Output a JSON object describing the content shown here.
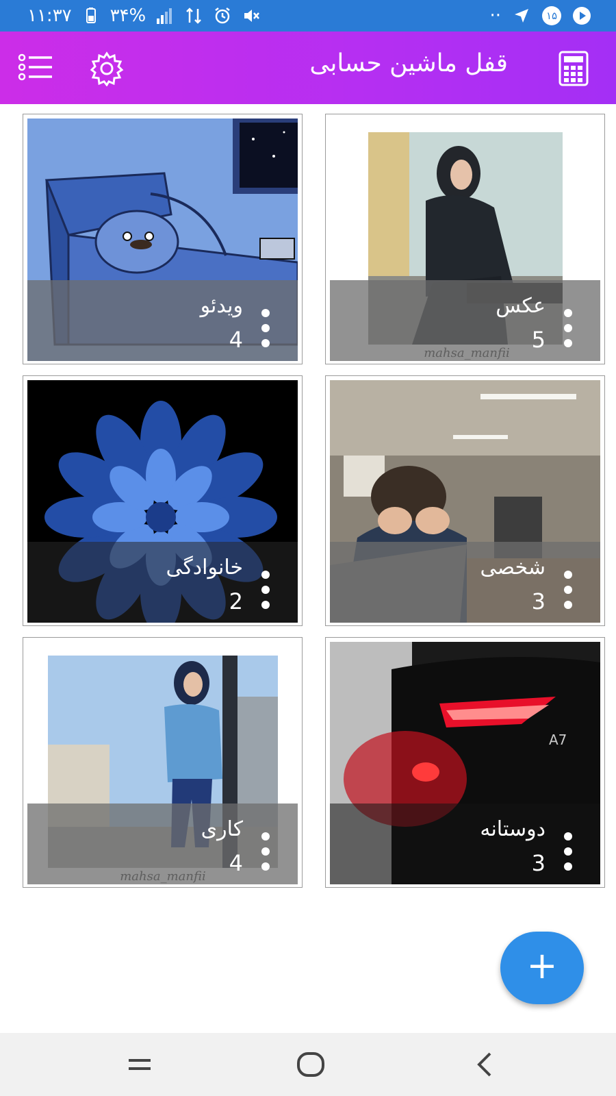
{
  "status_bar": {
    "time": "۱۱:۳۷",
    "battery": "۳۴%",
    "right_text": "··",
    "notification_count": "۱۵"
  },
  "app_bar": {
    "title": "قفل ماشین حسابی",
    "menu_icon": "menu-list-icon",
    "settings_icon": "gear-icon",
    "calculator_icon": "calculator-icon",
    "color_start": "#cc2de8",
    "color_end": "#a42ff5"
  },
  "folders": [
    {
      "name": "عکس",
      "count": "5",
      "thumb": "woman-sitting-photo",
      "caption": "mahsa_manfii"
    },
    {
      "name": "ویدئو",
      "count": "4",
      "thumb": "cartoon-bird-in-bed",
      "caption": ""
    },
    {
      "name": "شخصی",
      "count": "3",
      "thumb": "man-at-laptop-photo",
      "caption": ""
    },
    {
      "name": "خانوادگی",
      "count": "2",
      "thumb": "blue-flower-photo",
      "caption": ""
    },
    {
      "name": "دوستانه",
      "count": "3",
      "thumb": "red-car-taillight-photo",
      "caption": "A7"
    },
    {
      "name": "کاری",
      "count": "4",
      "thumb": "woman-standing-photo",
      "caption": "mahsa_manfii"
    }
  ],
  "fab": {
    "label": "+",
    "color": "#2f8fe8"
  },
  "nav": {
    "recents": "recents-icon",
    "home": "home-icon",
    "back": "back-icon"
  }
}
